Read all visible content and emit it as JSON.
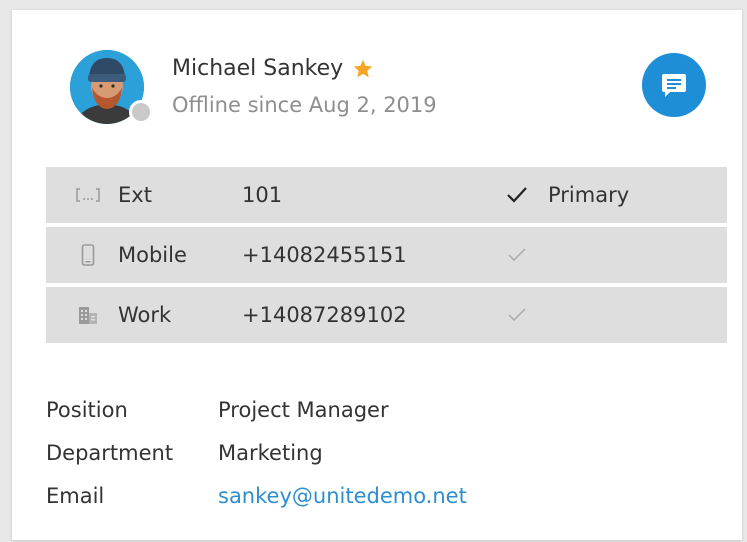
{
  "contact": {
    "name": "Michael Sankey",
    "status": "Offline since Aug 2, 2019",
    "favorite": true,
    "presence": "offline"
  },
  "colors": {
    "accent": "#1e8fd6",
    "star": "#f5a623",
    "row_bg": "#dedede",
    "link": "#2c8fd0",
    "presence_offline": "#c9c9c9"
  },
  "phones": [
    {
      "icon": "extension-icon",
      "label": "Ext",
      "number": "101",
      "primary": true,
      "primary_label": "Primary"
    },
    {
      "icon": "mobile-phone-icon",
      "label": "Mobile",
      "number": "+14082455151",
      "primary": false,
      "primary_label": ""
    },
    {
      "icon": "building-icon",
      "label": "Work",
      "number": "+14087289102",
      "primary": false,
      "primary_label": ""
    }
  ],
  "details": [
    {
      "label": "Position",
      "value": "Project Manager",
      "is_link": false
    },
    {
      "label": "Department",
      "value": "Marketing",
      "is_link": false
    },
    {
      "label": "Email",
      "value": "sankey@unitedemo.net",
      "is_link": true
    }
  ]
}
